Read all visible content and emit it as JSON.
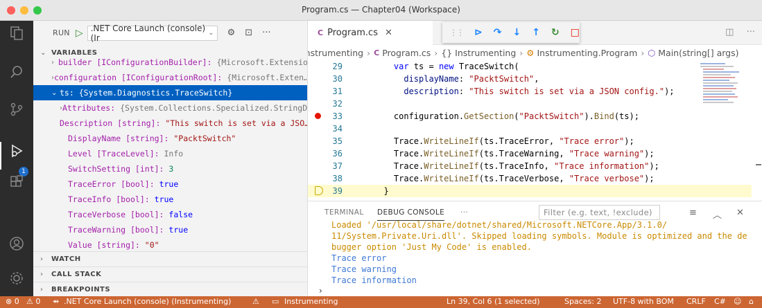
{
  "window": {
    "title": "Program.cs — Chapter04 (Workspace)",
    "traffic_colors": [
      "#fc605c",
      "#fdbc40",
      "#34c84a"
    ]
  },
  "run": {
    "label": "RUN",
    "config": ".NET Core Launch (console) (Ir",
    "settings_icon": "gear-icon",
    "terminal_icon": "terminal-icon",
    "more": "···"
  },
  "sections": {
    "variables": "VARIABLES",
    "watch": "WATCH",
    "call_stack": "CALL STACK",
    "breakpoints": "BREAKPOINTS"
  },
  "variables": [
    {
      "name": "builder [IConfigurationBuilder]:",
      "value": "{Microsoft.Extensio",
      "kind": "gray",
      "chev": "›",
      "indent": 0
    },
    {
      "name": "configuration [IConfigurationRoot]:",
      "value": "{Microsoft.Exten…",
      "kind": "gray",
      "chev": "›",
      "indent": 0
    },
    {
      "name": "ts:",
      "value": "{System.Diagnostics.TraceSwitch}",
      "kind": "plain",
      "chev": "⌄",
      "indent": 0,
      "selected": true
    },
    {
      "name": "Attributes:",
      "value": "{System.Collections.Specialized.StringD…",
      "kind": "gray",
      "chev": "›",
      "indent": 1
    },
    {
      "name": "Description [string]:",
      "value": "\"This switch is set via a JSO…",
      "kind": "str",
      "chev": "",
      "indent": 1
    },
    {
      "name": "DisplayName [string]:",
      "value": "\"PacktSwitch\"",
      "kind": "str",
      "chev": "",
      "indent": 1
    },
    {
      "name": "Level [TraceLevel]:",
      "value": "Info",
      "kind": "gray",
      "chev": "",
      "indent": 1
    },
    {
      "name": "SwitchSetting [int]:",
      "value": "3",
      "kind": "num",
      "chev": "",
      "indent": 1
    },
    {
      "name": "TraceError [bool]:",
      "value": "true",
      "kind": "kw",
      "chev": "",
      "indent": 1
    },
    {
      "name": "TraceInfo [bool]:",
      "value": "true",
      "kind": "kw",
      "chev": "",
      "indent": 1
    },
    {
      "name": "TraceVerbose [bool]:",
      "value": "false",
      "kind": "kw",
      "chev": "",
      "indent": 1
    },
    {
      "name": "TraceWarning [bool]:",
      "value": "true",
      "kind": "kw",
      "chev": "",
      "indent": 1
    },
    {
      "name": "Value [string]:",
      "value": "\"0\"",
      "kind": "str",
      "chev": "",
      "indent": 1
    }
  ],
  "activity_badge": "1",
  "editor": {
    "tab_label": "Program.cs",
    "tab_close": "✕",
    "breadcrumb": [
      "Instrumenting",
      "Program.cs",
      "{} Instrumenting",
      "Instrumenting.Program",
      "Main(string[] args)"
    ],
    "debug_toolbar": [
      "continue-icon",
      "step-over-icon",
      "step-into-icon",
      "step-out-icon",
      "restart-icon",
      "stop-icon"
    ]
  },
  "code_lines": [
    {
      "ln": "29",
      "text": "    var ts = new TraceSwitch("
    },
    {
      "ln": "30",
      "text": "      displayName: \"PacktSwitch\","
    },
    {
      "ln": "31",
      "text": "      description: \"This switch is set via a JSON config.\");"
    },
    {
      "ln": "32",
      "text": ""
    },
    {
      "ln": "33",
      "text": "    configuration.GetSection(\"PacktSwitch\").Bind(ts);",
      "breakpoint": true
    },
    {
      "ln": "34",
      "text": ""
    },
    {
      "ln": "35",
      "text": "    Trace.WriteLineIf(ts.TraceError, \"Trace error\");"
    },
    {
      "ln": "36",
      "text": "    Trace.WriteLineIf(ts.TraceWarning, \"Trace warning\");"
    },
    {
      "ln": "37",
      "text": "    Trace.WriteLineIf(ts.TraceInfo, \"Trace information\");"
    },
    {
      "ln": "38",
      "text": "    Trace.WriteLineIf(ts.TraceVerbose, \"Trace verbose\");"
    },
    {
      "ln": "39",
      "text": "  }",
      "current": true
    }
  ],
  "panel": {
    "tabs": [
      "TERMINAL",
      "DEBUG CONSOLE",
      "···"
    ],
    "active_tab": "DEBUG CONSOLE",
    "filter_placeholder": "Filter (e.g. text, !exclude)",
    "console_lines": [
      {
        "text": "Loaded '/usr/local/share/dotnet/shared/Microsoft.NETCore.App/3.1.0/",
        "kind": "warn"
      },
      {
        "text": "11/System.Private.Uri.dll'. Skipped loading symbols. Module is optimized and the de",
        "kind": "warn"
      },
      {
        "text": "bugger option 'Just My Code' is enabled.",
        "kind": "warn"
      },
      {
        "text": "Trace error",
        "kind": "info"
      },
      {
        "text": "Trace warning",
        "kind": "info"
      },
      {
        "text": "Trace information",
        "kind": "info"
      }
    ],
    "prompt": "›"
  },
  "status": {
    "errors": "⊗ 0",
    "warnings": "⚠ 0",
    "launch": ".NET Core Launch (console) (Instrumenting)",
    "folder": "Instrumenting",
    "position": "Ln 39, Col 6 (1 selected)",
    "spaces": "Spaces: 2",
    "encoding": "UTF-8 with BOM",
    "eol": "CRLF",
    "language": "C#",
    "color": "#cc6633"
  }
}
